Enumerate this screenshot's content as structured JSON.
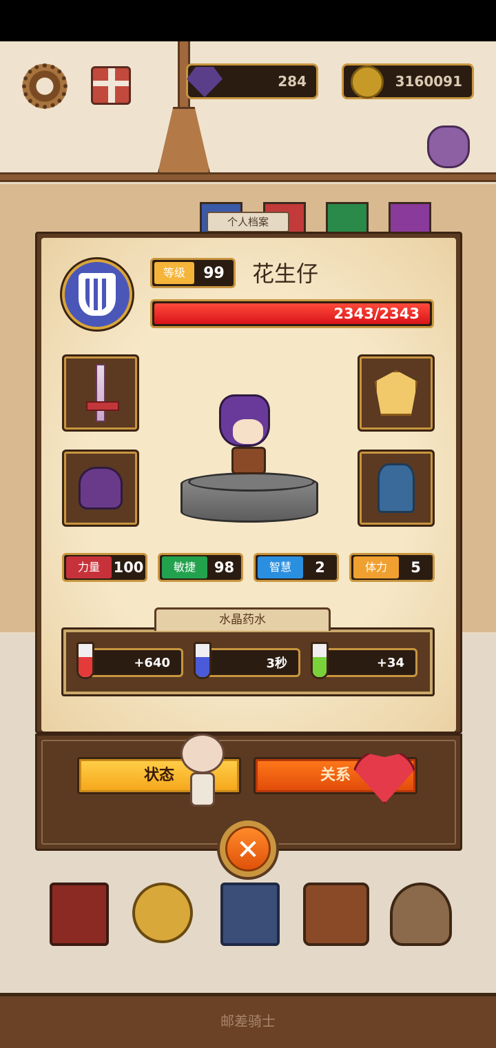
{
  "hud": {
    "gems": "284",
    "coins": "3160091"
  },
  "tab": {
    "profile": "个人档案"
  },
  "character": {
    "level_label": "等级",
    "level": "99",
    "name": "花生仔",
    "hp_text": "2343/2343",
    "hp_fraction": 1.0
  },
  "stats": [
    {
      "label": "力量",
      "value": "100",
      "color": "#c7323a"
    },
    {
      "label": "敏捷",
      "value": "98",
      "color": "#23a24e"
    },
    {
      "label": "智慧",
      "value": "2",
      "color": "#2b8fe0"
    },
    {
      "label": "体力",
      "value": "5",
      "color": "#f0a030"
    }
  ],
  "potions": {
    "title": "水晶药水",
    "items": [
      {
        "value": "+640",
        "icon": "hp-potion-icon",
        "color": "#e43a3a"
      },
      {
        "value": "3秒",
        "icon": "cooldown-potion-icon",
        "color": "#4a5ad8"
      },
      {
        "value": "+34",
        "icon": "stamina-potion-icon",
        "color": "#7ad23a"
      }
    ]
  },
  "buttons": {
    "status": "状态",
    "relation": "关系"
  },
  "footer": {
    "label": "邮差骑士"
  }
}
